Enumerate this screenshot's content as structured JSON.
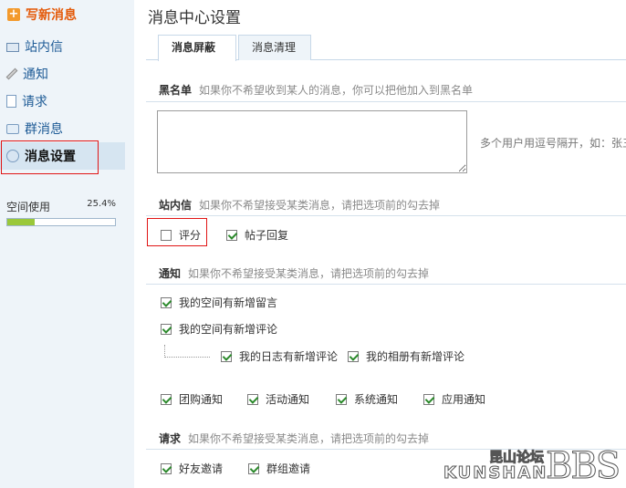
{
  "sidebar": {
    "compose_label": "写新消息",
    "items": [
      {
        "label": "站内信",
        "icon": "envelope-icon"
      },
      {
        "label": "通知",
        "icon": "pencil-icon"
      },
      {
        "label": "请求",
        "icon": "document-icon"
      },
      {
        "label": "群消息",
        "icon": "chat-bubble-icon"
      },
      {
        "label": "消息设置",
        "icon": "settings-icon"
      }
    ],
    "space": {
      "label": "空间使用",
      "percent_text": "25.4%",
      "used_fraction": 0.254
    }
  },
  "main": {
    "title": "消息中心设置",
    "tabs": [
      {
        "label": "消息屏蔽"
      },
      {
        "label": "消息清理"
      }
    ],
    "blacklist": {
      "title": "黑名单",
      "desc": "如果你不希望收到某人的消息，你可以把他加入到黑名单",
      "hint": "多个用户用逗号隔开，如：张三"
    },
    "pm": {
      "title": "站内信",
      "desc": "如果你不希望接受某类消息，请把选项前的勾去掉",
      "options": [
        {
          "label": "评分",
          "checked": false
        },
        {
          "label": "帖子回复",
          "checked": true
        }
      ]
    },
    "notice": {
      "title": "通知",
      "desc": "如果你不希望接受某类消息，请把选项前的勾去掉",
      "options": [
        {
          "label": "我的空间有新增留言",
          "checked": true
        },
        {
          "label": "我的空间有新增评论",
          "checked": true
        },
        {
          "label": "我的日志有新增评论",
          "checked": true
        },
        {
          "label": "我的相册有新增评论",
          "checked": true
        },
        {
          "label": "团购通知",
          "checked": true
        },
        {
          "label": "活动通知",
          "checked": true
        },
        {
          "label": "系统通知",
          "checked": true
        },
        {
          "label": "应用通知",
          "checked": true
        }
      ]
    },
    "request": {
      "title": "请求",
      "desc": "如果你不希望接受某类消息，请把选项前的勾去掉",
      "options": [
        {
          "label": "好友邀请",
          "checked": true
        },
        {
          "label": "群组邀请",
          "checked": true
        }
      ]
    }
  },
  "watermark": {
    "cn": "昆山论坛",
    "en": "KUNSHAN",
    "bbs": "BBS"
  },
  "colors": {
    "accent": "#e45a0a",
    "link": "#1e5b96",
    "highlight": "#e01515",
    "sidebar_bg": "#eef4f9"
  }
}
